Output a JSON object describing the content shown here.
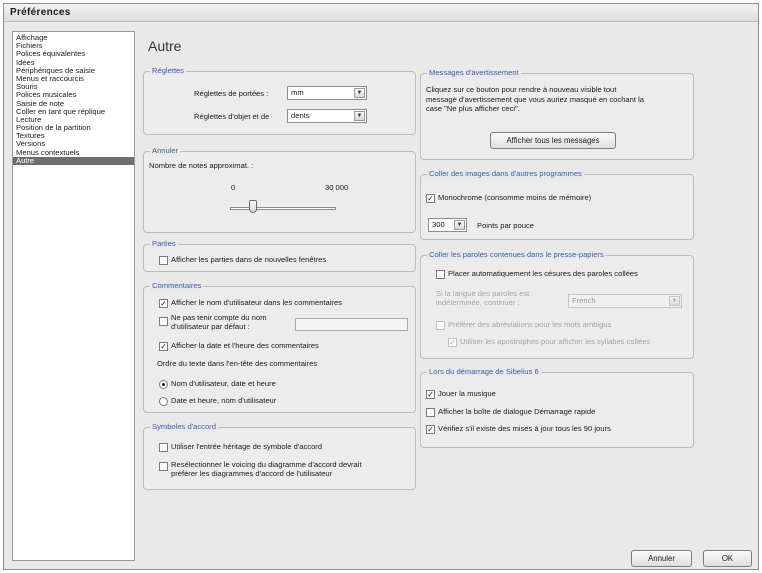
{
  "window": {
    "title": "Préférences"
  },
  "sidebar": {
    "items": [
      {
        "label": "Affichage"
      },
      {
        "label": "Fichiers"
      },
      {
        "label": "Polices équivalentes"
      },
      {
        "label": "Idées"
      },
      {
        "label": "Périphériques de saisie"
      },
      {
        "label": "Menus et raccourcis"
      },
      {
        "label": "Souris"
      },
      {
        "label": "Polices musicales"
      },
      {
        "label": "Saisie de note"
      },
      {
        "label": "Coller en tant que réplique"
      },
      {
        "label": "Lecture"
      },
      {
        "label": "Position de la partition"
      },
      {
        "label": "Textures"
      },
      {
        "label": "Versions"
      },
      {
        "label": "Menus contextuels"
      },
      {
        "label": "Autre"
      }
    ],
    "selected": "Autre"
  },
  "page_title": "Autre",
  "reglettes": {
    "legend": "Réglettes",
    "portees_label": "Réglettes de portées :",
    "portees_value": "mm",
    "objet_label": "Réglettes d'objet et de",
    "objet_value": "dents"
  },
  "annuler": {
    "legend": "Annuler",
    "notes_label": "Nombre de notes approximat. :",
    "min_label": "0",
    "max_label": "30 000",
    "slider_fraction": 0.22
  },
  "parties": {
    "legend": "Parties",
    "nouvelles_fenetres": {
      "label": "Afficher les parties dans de nouvelles fenêtres",
      "checked": false
    }
  },
  "commentaires": {
    "legend": "Commentaires",
    "nom_utilisateur": {
      "label": "Afficher le nom d'utilisateur dans les commentaires",
      "checked": true
    },
    "ignorer_nom_line1": "Ne pas tenir compte du nom",
    "ignorer_nom_line2": "d'utilisateur par défaut :",
    "ignorer_nom_checked": false,
    "ignorer_nom_value": "",
    "date_heure": {
      "label": "Afficher la date et l'heure des commentaires",
      "checked": true
    },
    "ordre_label": "Ordre du texte dans l'en-tête des commentaires",
    "radio1": {
      "label": "Nom d'utilisateur, date et heure",
      "selected": true
    },
    "radio2": {
      "label": "Date et heure, nom d'utilisateur",
      "selected": false
    }
  },
  "symboles": {
    "legend": "Symboles d'accord",
    "heritage": {
      "label": "Utiliser l'entrée héritage de symbole d'accord",
      "checked": false
    },
    "voicing_line1": "Resélectionner le voicing du diagramme d'accord devrait",
    "voicing_line2": "préférer les diagrammes d'accord de l'utilisateur",
    "voicing_checked": false
  },
  "messages": {
    "legend": "Messages d'avertissement",
    "text_line1": "Cliquez sur ce bouton pour rendre à nouveau visible tout",
    "text_line2": "message d'avertissement que vous auriez masqué en cochant la",
    "text_line3": "case \"Ne plus afficher ceci\".",
    "button_label": "Afficher tous les messages"
  },
  "coller_images": {
    "legend": "Coller des images dans d'autres programmes",
    "monochrome": {
      "label": "Monochrome (consomme moins de mémoire)",
      "checked": true
    },
    "dpi_value": "300",
    "dpi_label": "Points par pouce"
  },
  "coller_paroles": {
    "legend": "Coller les paroles contenues dans le presse-papiers",
    "cesures": {
      "label": "Placer automatiquement les césures des paroles collées",
      "checked": false
    },
    "langue_line1": "Si la langue des paroles est",
    "langue_line2": "indéterminée, continuer :",
    "langue_value": "French",
    "abreviations": {
      "label": "Préférer des abréviations pour les mots ambigus",
      "checked": false
    },
    "apostrophes": {
      "label": "Utiliser les apostrophes pour afficher les syllabes collées",
      "checked": true
    }
  },
  "demarrage": {
    "legend": "Lors du démarrage de Sibelius 6",
    "jouer": {
      "label": "Jouer la musique",
      "checked": true
    },
    "boite": {
      "label": "Afficher la boîte de dialogue Démarrage rapide",
      "checked": false
    },
    "mises_a_jour": {
      "label": "Vérifiez s'il existe des mises à jour tous les 90 jours",
      "checked": true
    }
  },
  "footer": {
    "cancel_label": "Annuler",
    "ok_label": "OK"
  }
}
